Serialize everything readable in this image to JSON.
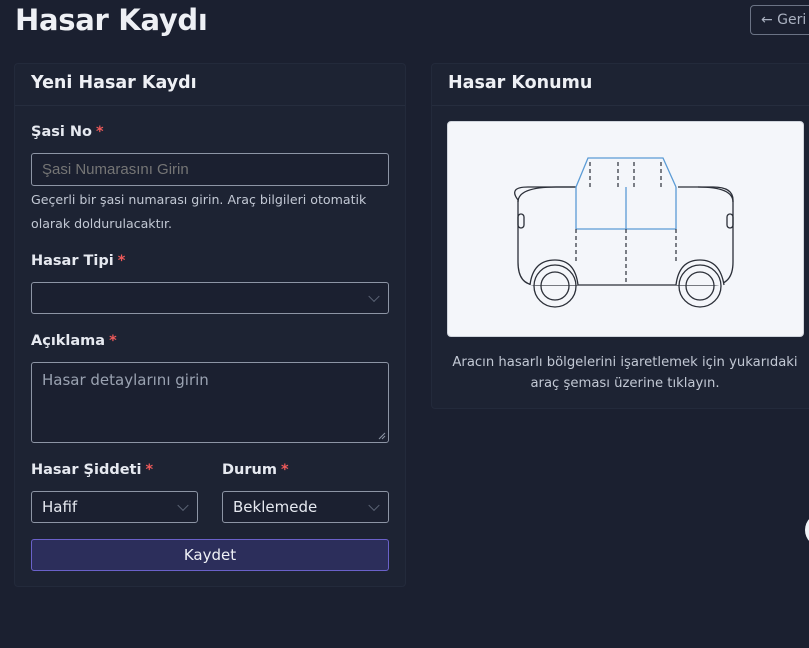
{
  "header": {
    "title": "Hasar Kaydı",
    "back_label": "← Geri"
  },
  "form": {
    "title": "Yeni Hasar Kaydı",
    "chassis": {
      "label": "Şasi No",
      "required_mark": "*",
      "placeholder": "Şasi Numarasını Girin",
      "help": "Geçerli bir şasi numarası girin. Araç bilgileri otomatik olarak doldurulacaktır."
    },
    "damage_type": {
      "label": "Hasar Tipi",
      "required_mark": "*",
      "value": ""
    },
    "description": {
      "label": "Açıklama",
      "required_mark": "*",
      "placeholder": "Hasar detaylarını girin"
    },
    "severity": {
      "label": "Hasar Şiddeti",
      "required_mark": "*",
      "value": "Hafif"
    },
    "status": {
      "label": "Durum",
      "required_mark": "*",
      "value": "Beklemede"
    },
    "submit_label": "Kaydet"
  },
  "location": {
    "title": "Hasar Konumu",
    "diagram_icon": "car-side-diagram",
    "help": "Aracın hasarlı bölgelerini işaretlemek için yukarıdaki araç şeması üzerine tıklayın."
  },
  "colors": {
    "background": "#1b2030",
    "card": "#1d2333",
    "required": "#ef5a5a",
    "primary_button": "#2c2e5b",
    "primary_border": "#6a61c9",
    "highlight": "#5b9bd5"
  }
}
